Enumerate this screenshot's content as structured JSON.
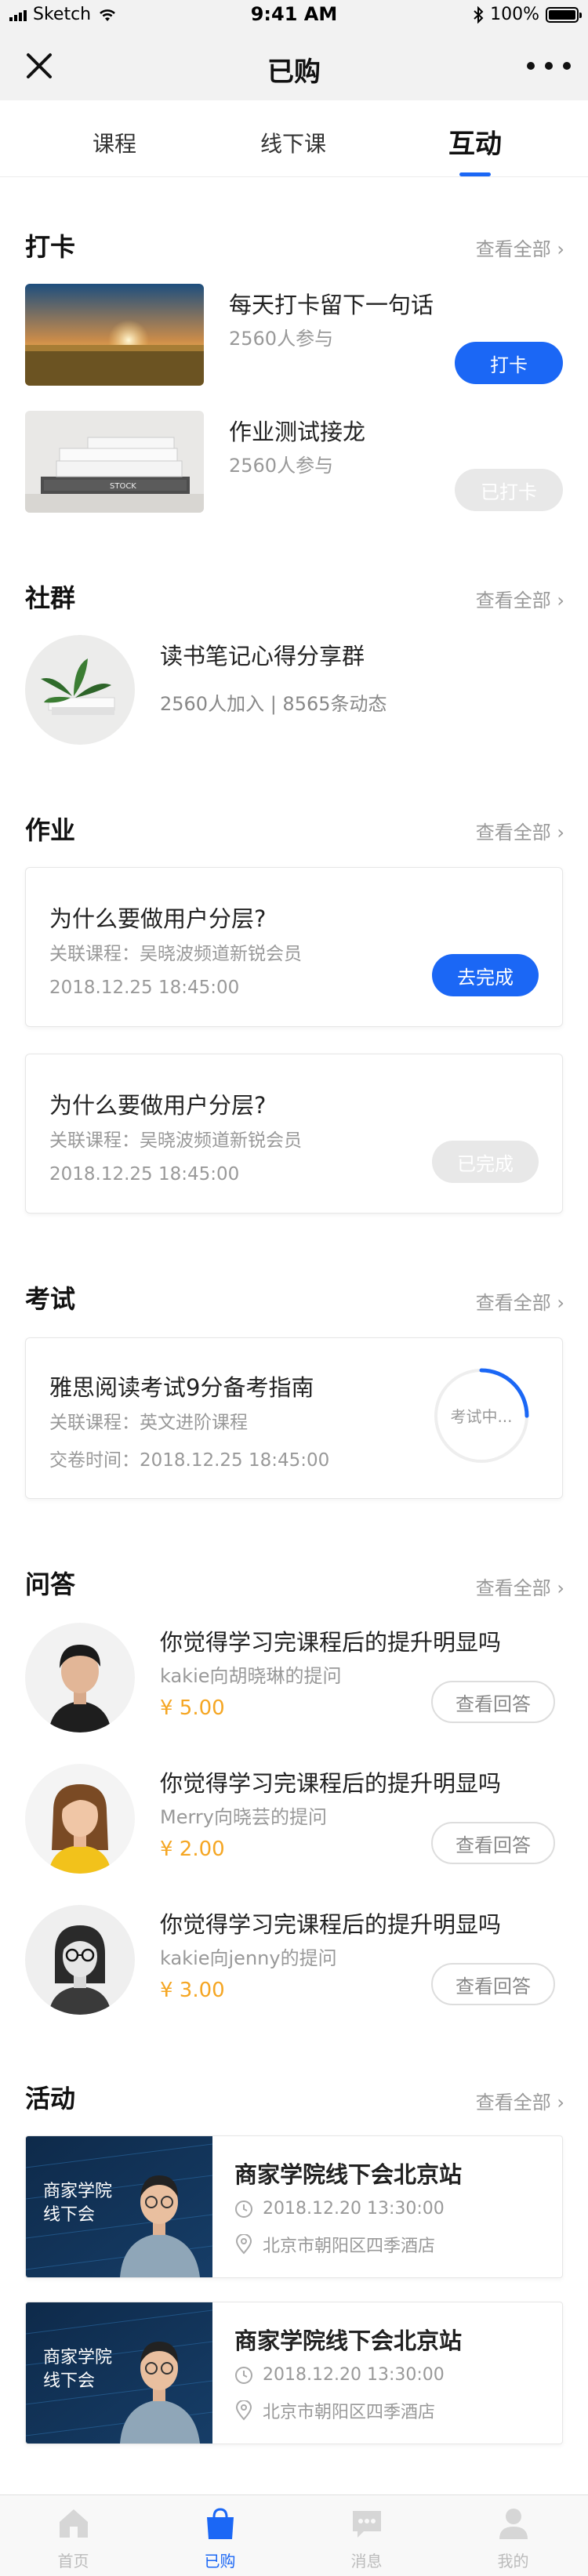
{
  "status_bar": {
    "carrier": "Sketch",
    "time": "9:41 AM",
    "battery": "100%"
  },
  "nav": {
    "title": "已购"
  },
  "tabs": [
    {
      "label": "课程"
    },
    {
      "label": "线下课"
    },
    {
      "label": "互动"
    }
  ],
  "active_tab": "互动",
  "checkin": {
    "title": "打卡",
    "see_all": "查看全部 ›",
    "items": [
      {
        "title": "每天打卡留下一句话",
        "participants": "2560人参与",
        "button": "打卡",
        "button_state": "active"
      },
      {
        "title": "作业测试接龙",
        "participants": "2560人参与",
        "button": "已打卡",
        "button_state": "disabled"
      }
    ]
  },
  "community": {
    "title": "社群",
    "see_all": "查看全部 ›",
    "group": {
      "name": "读书笔记心得分享群",
      "stats": "2560人加入 | 8565条动态"
    }
  },
  "homework": {
    "title": "作业",
    "see_all": "查看全部 ›",
    "items": [
      {
        "title": "为什么要做用户分层?",
        "course": "关联课程：吴晓波频道新锐会员",
        "time": "2018.12.25 18:45:00",
        "button": "去完成",
        "button_state": "active"
      },
      {
        "title": "为什么要做用户分层?",
        "course": "关联课程：吴晓波频道新锐会员",
        "time": "2018.12.25 18:45:00",
        "button": "已完成",
        "button_state": "disabled"
      }
    ]
  },
  "exam": {
    "title": "考试",
    "see_all": "查看全部 ›",
    "item": {
      "title": "雅思阅读考试9分备考指南",
      "course": "关联课程：英文进阶课程",
      "submit_time": "交卷时间：2018.12.25 18:45:00",
      "status": "考试中...",
      "progress": 0.25
    }
  },
  "qa": {
    "title": "问答",
    "see_all": "查看全部 ›",
    "items": [
      {
        "question": "你觉得学习完课程后的提升明显吗",
        "asker": "kakie向胡晓琳的提问",
        "price": "¥ 5.00",
        "button": "查看回答"
      },
      {
        "question": "你觉得学习完课程后的提升明显吗",
        "asker": "Merry向晓芸的提问",
        "price": "¥ 2.00",
        "button": "查看回答"
      },
      {
        "question": "你觉得学习完课程后的提升明显吗",
        "asker": "kakie向jenny的提问",
        "price": "¥ 3.00",
        "button": "查看回答"
      }
    ]
  },
  "activity": {
    "title": "活动",
    "see_all": "查看全部 ›",
    "items": [
      {
        "image_text": "商家学院\n线下会",
        "title": "商家学院线下会北京站",
        "datetime": "2018.12.20   13:30:00",
        "location": "北京市朝阳区四季酒店"
      },
      {
        "image_text": "商家学院\n线下会",
        "title": "商家学院线下会北京站",
        "datetime": "2018.12.20   13:30:00",
        "location": "北京市朝阳区四季酒店"
      }
    ]
  },
  "tabbar": [
    {
      "label": "首页",
      "icon": "home-icon",
      "active": false
    },
    {
      "label": "已购",
      "icon": "bag-icon",
      "active": true
    },
    {
      "label": "消息",
      "icon": "message-icon",
      "active": false
    },
    {
      "label": "我的",
      "icon": "user-icon",
      "active": false
    }
  ],
  "colors": {
    "accent": "#1b67f5",
    "price": "#f5a623",
    "disabled": "#e8e8e8",
    "muted_text": "#999999"
  }
}
